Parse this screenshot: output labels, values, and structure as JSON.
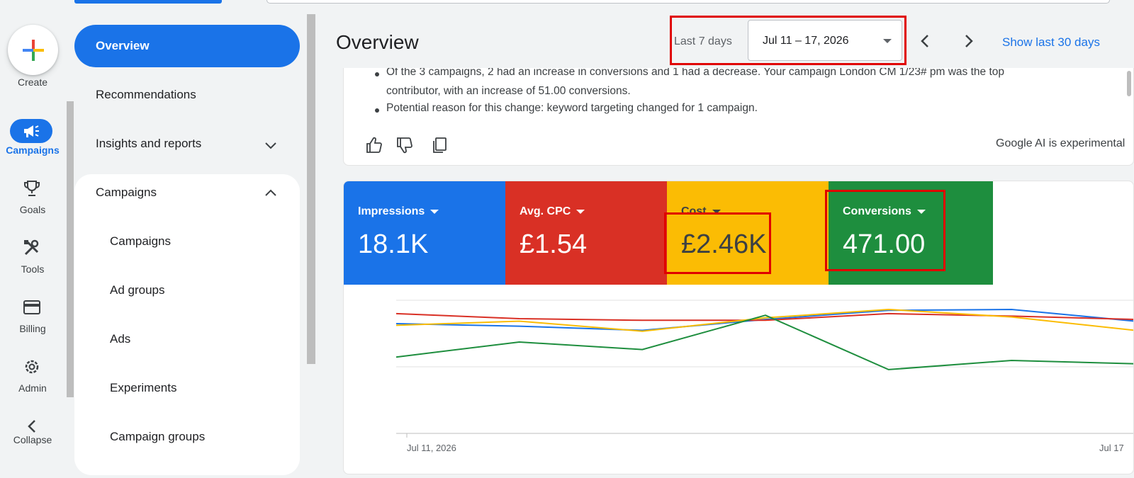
{
  "rail": {
    "create_label": "Create",
    "items": [
      {
        "label": "Campaigns",
        "icon": "megaphone-icon",
        "active": true
      },
      {
        "label": "Goals",
        "icon": "trophy-icon"
      },
      {
        "label": "Tools",
        "icon": "tools-icon"
      },
      {
        "label": "Billing",
        "icon": "credit-card-icon"
      },
      {
        "label": "Admin",
        "icon": "gear-icon"
      },
      {
        "label": "Collapse",
        "icon": "chevron-left-icon"
      }
    ]
  },
  "nav": {
    "overview": "Overview",
    "recommendations": "Recommendations",
    "insights": "Insights and reports",
    "campaigns": "Campaigns",
    "sub_items": [
      "Campaigns",
      "Ad groups",
      "Ads",
      "Experiments",
      "Campaign groups"
    ]
  },
  "header": {
    "title": "Overview",
    "range_label": "Last 7 days",
    "date_range": "Jul 11 – 17, 2026",
    "show_last": "Show last 30 days"
  },
  "insight": {
    "line1": "Of the 3 campaigns, 2 had an increase in conversions and 1 had a decrease. Your campaign London CM 1/23# pm was the top",
    "line2": "contributor, with an increase of 51.00 conversions.",
    "line3": "Potential reason for this change: keyword targeting changed for 1 campaign.",
    "note": "Google AI is experimental"
  },
  "metrics": [
    {
      "label": "Impressions",
      "value": "18.1K",
      "color": "#1a73e8",
      "text": "#ffffff"
    },
    {
      "label": "Avg. CPC",
      "value": "£1.54",
      "color": "#d93025",
      "text": "#ffffff"
    },
    {
      "label": "Cost",
      "value": "£2.46K",
      "color": "#fbbc04",
      "text": "#3c4043"
    },
    {
      "label": "Conversions",
      "value": "471.00",
      "color": "#1e8e3e",
      "text": "#ffffff"
    }
  ],
  "chart_data": {
    "type": "line",
    "x_labels": [
      "Jul 11, 2026",
      "Jul 17"
    ],
    "x": [
      11,
      12,
      13,
      14,
      15,
      16,
      17
    ],
    "series": [
      {
        "color": "#1a73e8",
        "values": [
          0.72,
          0.69,
          0.64,
          0.77,
          0.88,
          0.89,
          0.75
        ]
      },
      {
        "color": "#d93025",
        "values": [
          0.84,
          0.78,
          0.76,
          0.76,
          0.84,
          0.81,
          0.77
        ]
      },
      {
        "color": "#fbbc04",
        "values": [
          0.7,
          0.75,
          0.63,
          0.79,
          0.89,
          0.8,
          0.64
        ]
      },
      {
        "color": "#1e8e3e",
        "values": [
          0.32,
          0.5,
          0.41,
          0.82,
          0.17,
          0.28,
          0.24
        ]
      }
    ]
  }
}
